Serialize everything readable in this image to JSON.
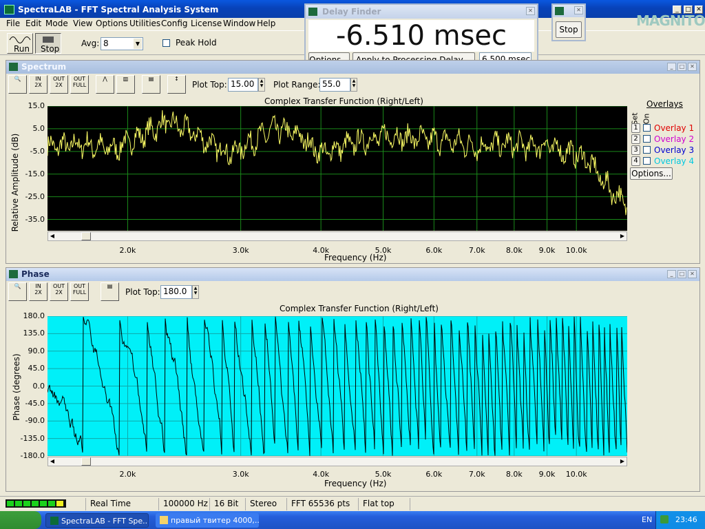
{
  "app": {
    "title": "SpectraLAB - FFT Spectral Analysis System"
  },
  "menu": [
    "File",
    "Edit",
    "Mode",
    "View",
    "Options",
    "Utilities",
    "Config",
    "License",
    "Window",
    "Help"
  ],
  "toolbar": {
    "run_label": "Run",
    "stop_label": "Stop",
    "avg_label": "Avg:",
    "avg_value": "8",
    "peak_hold_label": "Peak Hold"
  },
  "delay_finder": {
    "title": "Delay Finder",
    "value": "-6.510 msec",
    "options_label": "Options...",
    "apply_label": "Apply to Processing Delay -->",
    "delay_value": "6.500 msec"
  },
  "mini_stop": {
    "label": "Stop"
  },
  "watermark": {
    "text": "MAGNITOLA"
  },
  "spectrum": {
    "title": "Spectrum",
    "plot_top_label": "Plot Top:",
    "plot_top_value": "15.00",
    "plot_range_label": "Plot Range:",
    "plot_range_value": "55.0",
    "overlays_label": "Overlays",
    "set_label": "Set",
    "on_label": "On",
    "overlays": [
      {
        "num": "1",
        "name": "Overlay 1",
        "color": "#e00000"
      },
      {
        "num": "2",
        "name": "Overlay 2",
        "color": "#d000d0"
      },
      {
        "num": "3",
        "name": "Overlay 3",
        "color": "#0000d0"
      },
      {
        "num": "4",
        "name": "Overlay 4",
        "color": "#00c8e0"
      }
    ],
    "options_label": "Options..."
  },
  "phase": {
    "title": "Phase",
    "plot_top_label": "Plot Top:",
    "plot_top_value": "180.0"
  },
  "chart_data": [
    {
      "type": "line",
      "title": "Complex Transfer Function (Right/Left)",
      "xlabel": "Frequency (Hz)",
      "ylabel": "Relative Amplitude (dB)",
      "yticks": [
        "15.0",
        "5.0",
        "-5.0",
        "-15.0",
        "-25.0",
        "-35.0"
      ],
      "ylim": [
        -40,
        15
      ],
      "xticks": [
        "2.0k",
        "3.0k",
        "4.0k",
        "5.0k",
        "6.0k",
        "7.0k",
        "8.0k",
        "9.0k",
        "10.0k"
      ],
      "x_scale": "log",
      "background": "#000000",
      "grid_color": "#1a8a1a",
      "line_color": "#ffff66",
      "series": [
        {
          "x": [
            1500,
            1700,
            1900,
            2100,
            2300,
            2500,
            2700,
            2900,
            3100,
            3400,
            3700,
            4000,
            4300,
            4700,
            5100,
            5500,
            6000,
            6500,
            7000,
            7500,
            8000,
            8500,
            9000,
            9500,
            10000,
            10500,
            11000,
            11500,
            12000
          ],
          "y": [
            -3,
            -2,
            -4,
            2,
            8,
            4,
            -2,
            -6,
            -1,
            5,
            2,
            -6,
            -3,
            0,
            2,
            1,
            0,
            -1,
            -3,
            -2,
            -2,
            -3,
            -2,
            -5,
            -6,
            -10,
            -18,
            -24,
            -29
          ]
        }
      ]
    },
    {
      "type": "line",
      "title": "Complex Transfer Function (Right/Left)",
      "xlabel": "Frequency (Hz)",
      "ylabel": "Phase (degrees)",
      "yticks": [
        "180.0",
        "135.0",
        "90.0",
        "45.0",
        "0.0",
        "-45.0",
        "-90.0",
        "-135.0",
        "-180.0"
      ],
      "ylim": [
        -180,
        180
      ],
      "xticks": [
        "2.0k",
        "3.0k",
        "4.0k",
        "5.0k",
        "6.0k",
        "7.0k",
        "8.0k",
        "9.0k",
        "10.0k"
      ],
      "x_scale": "log",
      "background": "#00f0f8",
      "grid_color": "#10a8a8",
      "line_color": "#000000"
    }
  ],
  "status": {
    "mode": "Real Time",
    "rate": "100000 Hz",
    "bits": "16 Bit",
    "channels": "Stereo",
    "fft": "FFT 65536 pts",
    "window": "Flat top"
  },
  "taskbar": {
    "task1": "SpectraLAB - FFT Spe...",
    "task2": "правый твитер 4000,...",
    "lang": "EN",
    "clock": "23:46"
  }
}
